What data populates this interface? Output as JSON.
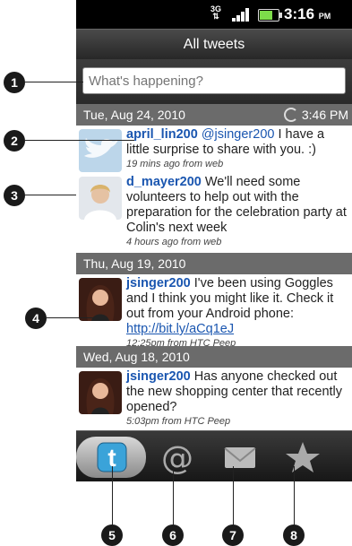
{
  "status": {
    "network": "3G",
    "time": "3:16",
    "ampm": "PM"
  },
  "header": {
    "title": "All tweets"
  },
  "compose": {
    "placeholder": "What's happening?"
  },
  "groups": [
    {
      "date": "Tue, Aug 24, 2010",
      "refresh_time": "3:46 PM"
    },
    {
      "date": "Thu, Aug 19, 2010"
    },
    {
      "date": "Wed, Aug 18, 2010"
    }
  ],
  "tweets": [
    {
      "author": "april_lin200",
      "mention": "@jsinger200",
      "text": " I have a little surprise to share with you. :)",
      "meta": "19 mins ago from web"
    },
    {
      "author": "d_mayer200",
      "text": " We'll need some volunteers to help out with the preparation for the celebration party at Colin's next week",
      "meta": "4 hours ago from web"
    },
    {
      "author": "jsinger200",
      "text": " I've been using Goggles and I think you might like it. Check it out from your Android phone: ",
      "link": "http://bit.ly/aCq1eJ",
      "meta": "12:25pm from  HTC Peep"
    },
    {
      "author": "jsinger200",
      "text": " Has anyone checked out the new shopping center that recently opened?",
      "meta": "5:03pm from  HTC Peep"
    }
  ],
  "tabs": [
    {
      "icon": "twitter-bird-icon",
      "active": true
    },
    {
      "icon": "at-sign-icon"
    },
    {
      "icon": "envelope-icon"
    },
    {
      "icon": "star-icon"
    }
  ],
  "callouts": [
    "1",
    "2",
    "3",
    "4",
    "5",
    "6",
    "7",
    "8"
  ]
}
